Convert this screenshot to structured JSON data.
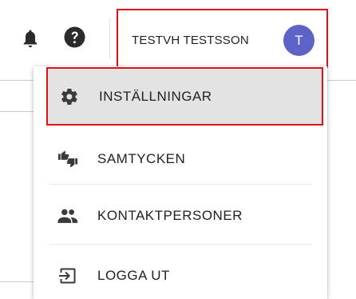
{
  "header": {
    "notifications_icon": "bell-icon",
    "help_icon": "help-circle-icon",
    "user": {
      "name": "TESTVH TESTSSON",
      "avatar_initial": "T",
      "avatar_color": "#5c62c6"
    },
    "highlight_color": "#e3101a"
  },
  "menu": {
    "items": [
      {
        "label": "INSTÄLLNINGAR",
        "icon": "gear-icon",
        "active": true
      },
      {
        "label": "SAMTYCKEN",
        "icon": "thumbs-up-down-icon",
        "active": false
      },
      {
        "label": "KONTAKTPERSONER",
        "icon": "people-icon",
        "active": false
      },
      {
        "label": "LOGGA UT",
        "icon": "logout-icon",
        "active": false
      }
    ]
  }
}
